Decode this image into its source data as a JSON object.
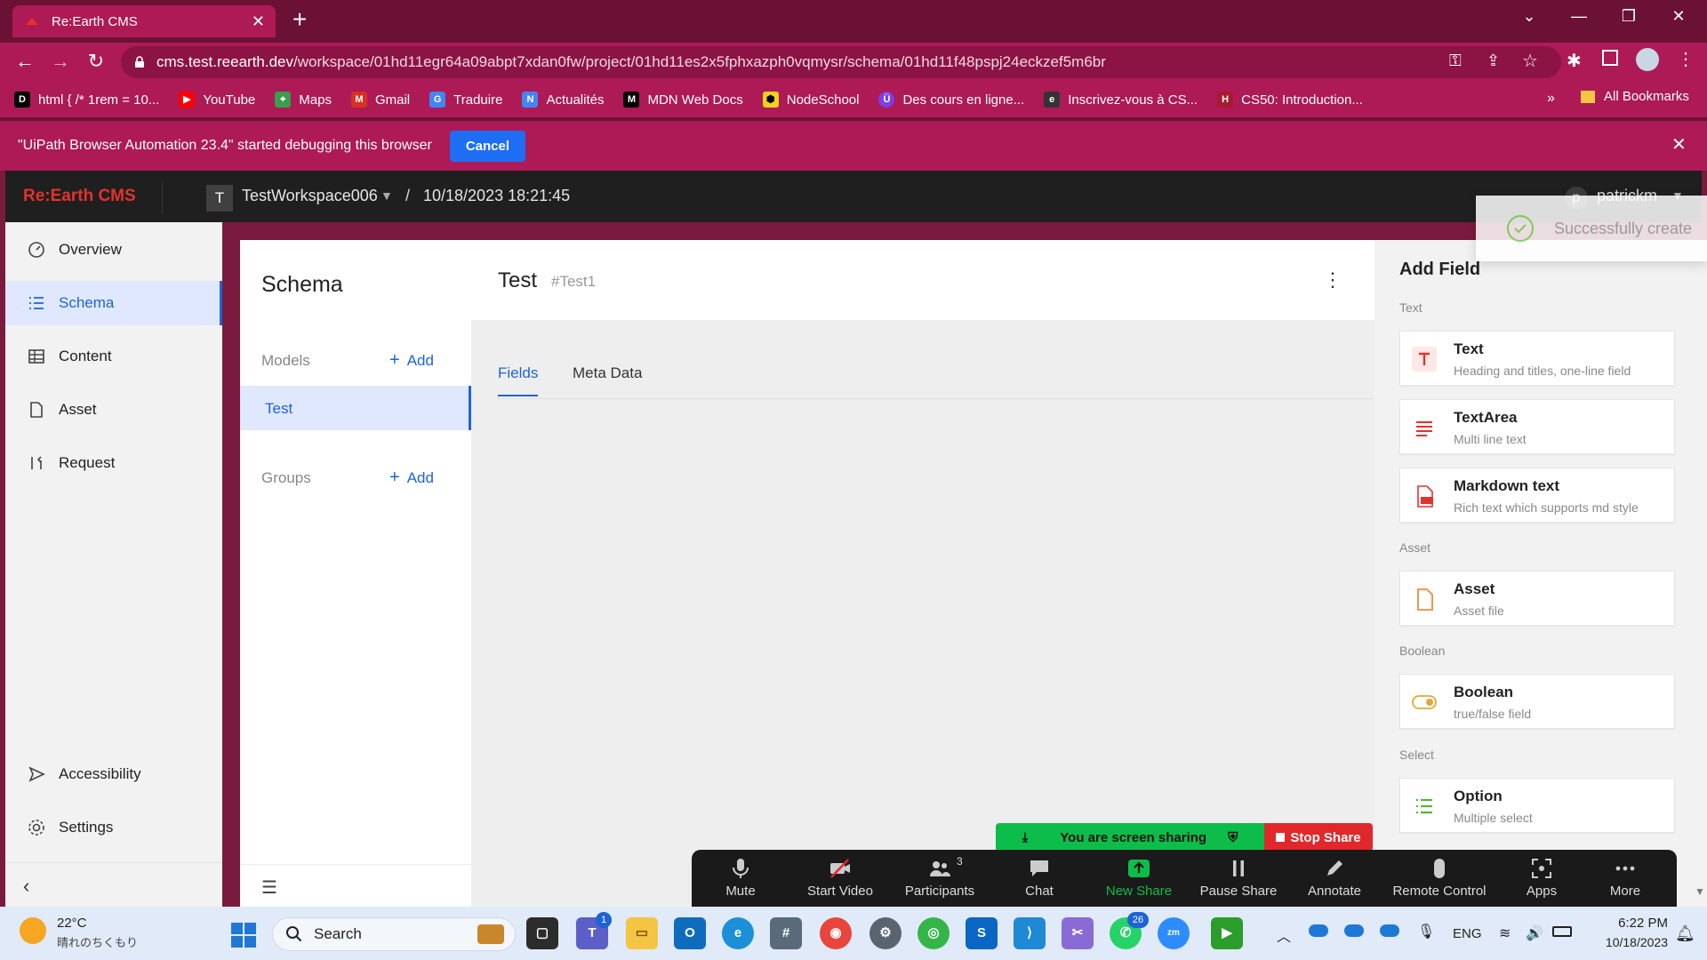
{
  "browser": {
    "tab_title": "Re:Earth CMS",
    "url_host": "cms.test.reearth.dev",
    "url_path": "/workspace/01hd11egr64a09abpt7xdan0fw/project/01hd11es2x5fphxazph0vqmysr/schema/01hd11f48pspj24eckzef5m6br",
    "bookmarks": [
      "html { /* 1rem = 10...",
      "YouTube",
      "Maps",
      "Gmail",
      "Traduire",
      "Actualités",
      "MDN Web Docs",
      "NodeSchool",
      "Des cours en ligne...",
      "Inscrivez-vous à CS...",
      "CS50: Introduction..."
    ],
    "all_bookmarks": "All Bookmarks",
    "debug_message": "\"UiPath Browser Automation 23.4\" started debugging this browser",
    "debug_cancel": "Cancel"
  },
  "app": {
    "brand": "Re:Earth CMS",
    "workspace_avatar": "T",
    "workspace_name": "TestWorkspace006",
    "breadcrumb_sep": "/",
    "project_name": "10/18/2023 18:21:45",
    "user_avatar": "p",
    "user_name": "patrickm"
  },
  "nav": {
    "overview": "Overview",
    "schema": "Schema",
    "content": "Content",
    "asset": "Asset",
    "request": "Request",
    "accessibility": "Accessibility",
    "settings": "Settings"
  },
  "schema_panel": {
    "title": "Schema",
    "models_label": "Models",
    "add_label": "Add",
    "model_items": [
      "Test"
    ],
    "groups_label": "Groups"
  },
  "model": {
    "name": "Test",
    "key": "#Test1",
    "tabs": [
      "Fields",
      "Meta Data"
    ]
  },
  "add_field": {
    "title": "Add Field",
    "sections": {
      "text": "Text",
      "asset": "Asset",
      "boolean": "Boolean",
      "select": "Select"
    },
    "fields": {
      "text": {
        "name": "Text",
        "desc": "Heading and titles, one-line field"
      },
      "textarea": {
        "name": "TextArea",
        "desc": "Multi line text"
      },
      "markdown": {
        "name": "Markdown text",
        "desc": "Rich text which supports md style"
      },
      "asset": {
        "name": "Asset",
        "desc": "Asset file"
      },
      "boolean": {
        "name": "Boolean",
        "desc": "true/false field"
      },
      "option": {
        "name": "Option",
        "desc": "Multiple select"
      }
    }
  },
  "toast": {
    "message": "Successfully create"
  },
  "zoom": {
    "sharing_text": "You are screen sharing",
    "stop_share": "Stop Share",
    "buttons": [
      "Mute",
      "Start Video",
      "Participants",
      "Chat",
      "New Share",
      "Pause Share",
      "Annotate",
      "Remote Control",
      "Apps",
      "More"
    ],
    "participants_count": "3"
  },
  "taskbar": {
    "weather_temp": "22°C",
    "weather_desc": "晴れのちくもり",
    "search_placeholder": "Search",
    "teams_badge": "1",
    "whatsapp_badge": "26",
    "lang": "ENG",
    "time": "6:22 PM",
    "date": "10/18/2023"
  },
  "colors": {
    "browser_theme": "#ad1a55",
    "brand_red": "#e4322b",
    "accent_blue": "#1e63d6",
    "zoom_green": "#0dbd4a",
    "stop_red": "#e0282c"
  }
}
